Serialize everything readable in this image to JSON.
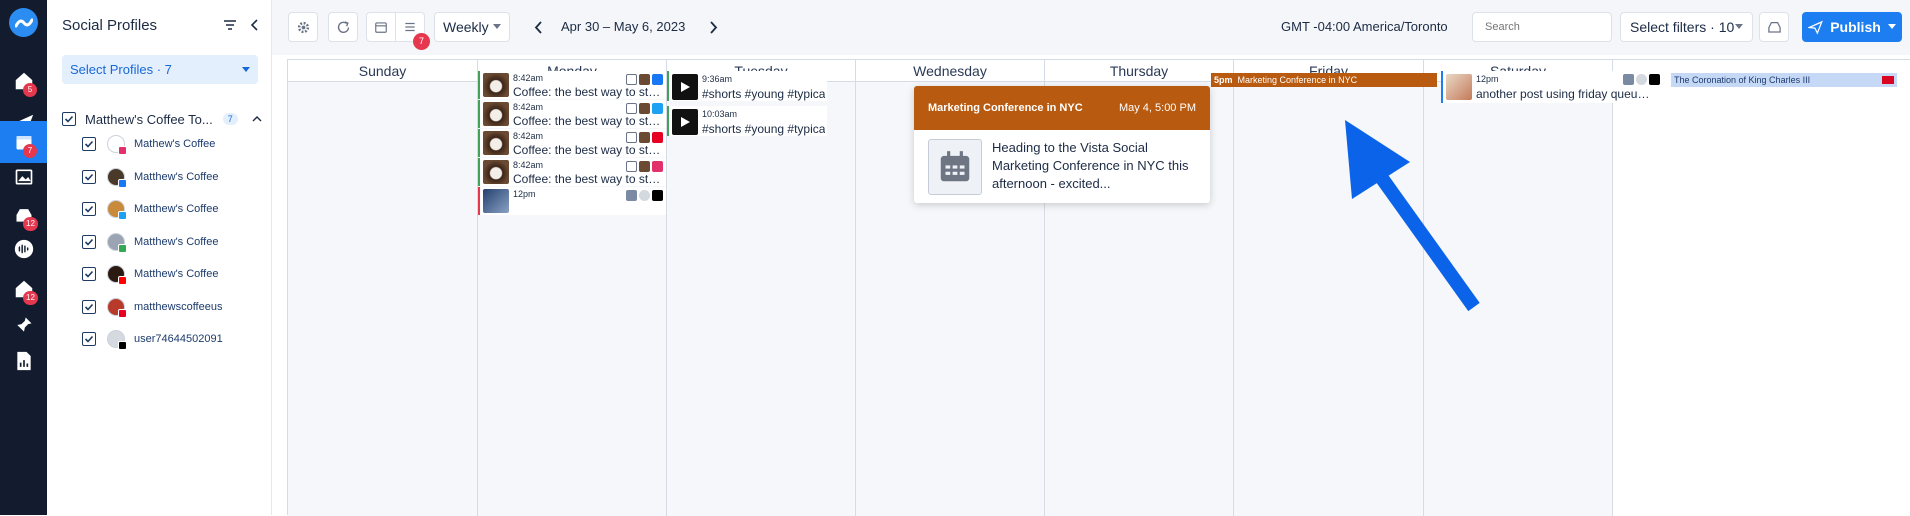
{
  "rail": {
    "items": [
      {
        "name": "home",
        "badge": "5"
      },
      {
        "name": "publish",
        "badge": ""
      },
      {
        "name": "calendar",
        "badge": "7",
        "active": true
      },
      {
        "name": "media",
        "badge": ""
      },
      {
        "name": "inbox",
        "badge": "12"
      },
      {
        "name": "listening",
        "badge": ""
      },
      {
        "name": "reviews",
        "badge": "12"
      },
      {
        "name": "pin",
        "badge": ""
      },
      {
        "name": "reports",
        "badge": ""
      }
    ]
  },
  "sidebar": {
    "title": "Social Profiles",
    "select_profiles": "Select Profiles · 7",
    "group": {
      "name": "Matthew's Coffee To...",
      "count": "7"
    },
    "profiles": [
      {
        "name": "Mathew's Coffee",
        "network": "instagram",
        "net_color": "#e1306c",
        "avatar_color": "#ffffff"
      },
      {
        "name": "Matthew's Coffee",
        "network": "facebook",
        "net_color": "#1877f2",
        "avatar_color": "#4a3828"
      },
      {
        "name": "Matthew's Coffee",
        "network": "twitter",
        "net_color": "#1da1f2",
        "avatar_color": "#c98a3c"
      },
      {
        "name": "Matthew's Coffee",
        "network": "google",
        "net_color": "#34a853",
        "avatar_color": "#9aa4b3"
      },
      {
        "name": "Matthew's Coffee",
        "network": "youtube",
        "net_color": "#ff0000",
        "avatar_color": "#2b1a12"
      },
      {
        "name": "matthewscoffeeus",
        "network": "pinterest",
        "net_color": "#e60023",
        "avatar_color": "#b83a2a"
      },
      {
        "name": "user74644502091",
        "network": "tiktok",
        "net_color": "#000000",
        "avatar_color": "#d5d9e0"
      }
    ]
  },
  "topbar": {
    "view": "Weekly",
    "date_range": "Apr 30 – May 6, 2023",
    "list_badge": "7",
    "timezone": "GMT -04:00 America/Toronto",
    "search_placeholder": "Search",
    "filters": "Select filters · 10",
    "publish": "Publish"
  },
  "calendar": {
    "days": [
      "Sunday",
      "Monday",
      "Tuesday",
      "Wednesday",
      "Thursday",
      "Friday",
      "Saturday"
    ],
    "monday_posts": [
      {
        "time": "8:42am",
        "text": "Coffee: the best way to start the d...",
        "net": "facebook",
        "net_color": "#1877f2"
      },
      {
        "time": "8:42am",
        "text": "Coffee: the best way to start the d...",
        "net": "twitter",
        "net_color": "#1da1f2"
      },
      {
        "time": "8:42am",
        "text": "Coffee: the best way to start the d...",
        "net": "pinterest",
        "net_color": "#e60023"
      },
      {
        "time": "8:42am",
        "text": "Coffee: the best way to start the d...",
        "net": "instagram",
        "net_color": "#e1306c"
      },
      {
        "time": "12pm",
        "text": "",
        "net": "tiktok",
        "net_color": "#000000"
      }
    ],
    "tuesday_posts": [
      {
        "time": "9:36am",
        "text": "#shorts #young #typica"
      },
      {
        "time": "10:03am",
        "text": "#shorts #young #typica"
      }
    ],
    "thursday_event": {
      "time": "5pm",
      "title": "Marketing Conference in NYC",
      "color": "#b85a0f"
    },
    "friday_post": {
      "time": "12pm",
      "text": "another post using friday queue la..."
    },
    "saturday_event": {
      "title": "The Coronation of King Charles III",
      "color": "#c5d8f5"
    },
    "tooltip": {
      "title": "Marketing Conference in NYC",
      "date": "May 4, 5:00 PM",
      "body": "Heading to the Vista Social Marketing Conference in NYC this afternoon - excited..."
    }
  },
  "colors": {
    "accent": "#1c7ef0",
    "rail_bg": "#131c2e",
    "event_orange": "#b85a0f",
    "arrow": "#0a63e8"
  }
}
